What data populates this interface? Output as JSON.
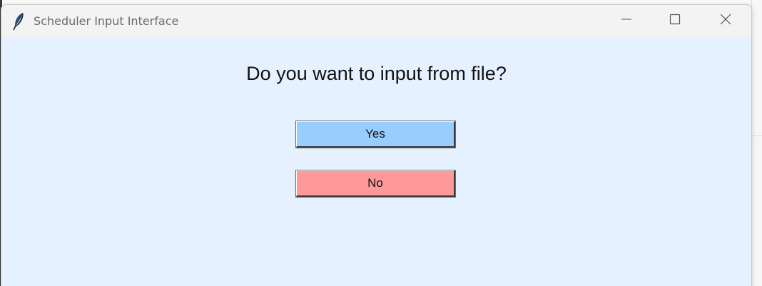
{
  "window": {
    "title": "Scheduler Input Interface",
    "app_icon": "feather-icon",
    "controls": {
      "minimize_icon": "minimize-icon",
      "maximize_icon": "maximize-icon",
      "close_icon": "close-icon"
    }
  },
  "dialog": {
    "question": "Do you want to input from file?",
    "yes_label": "Yes",
    "no_label": "No"
  },
  "colors": {
    "client_background": "#e6f1ff",
    "yes_button": "#99ccff",
    "no_button": "#ff9999"
  }
}
